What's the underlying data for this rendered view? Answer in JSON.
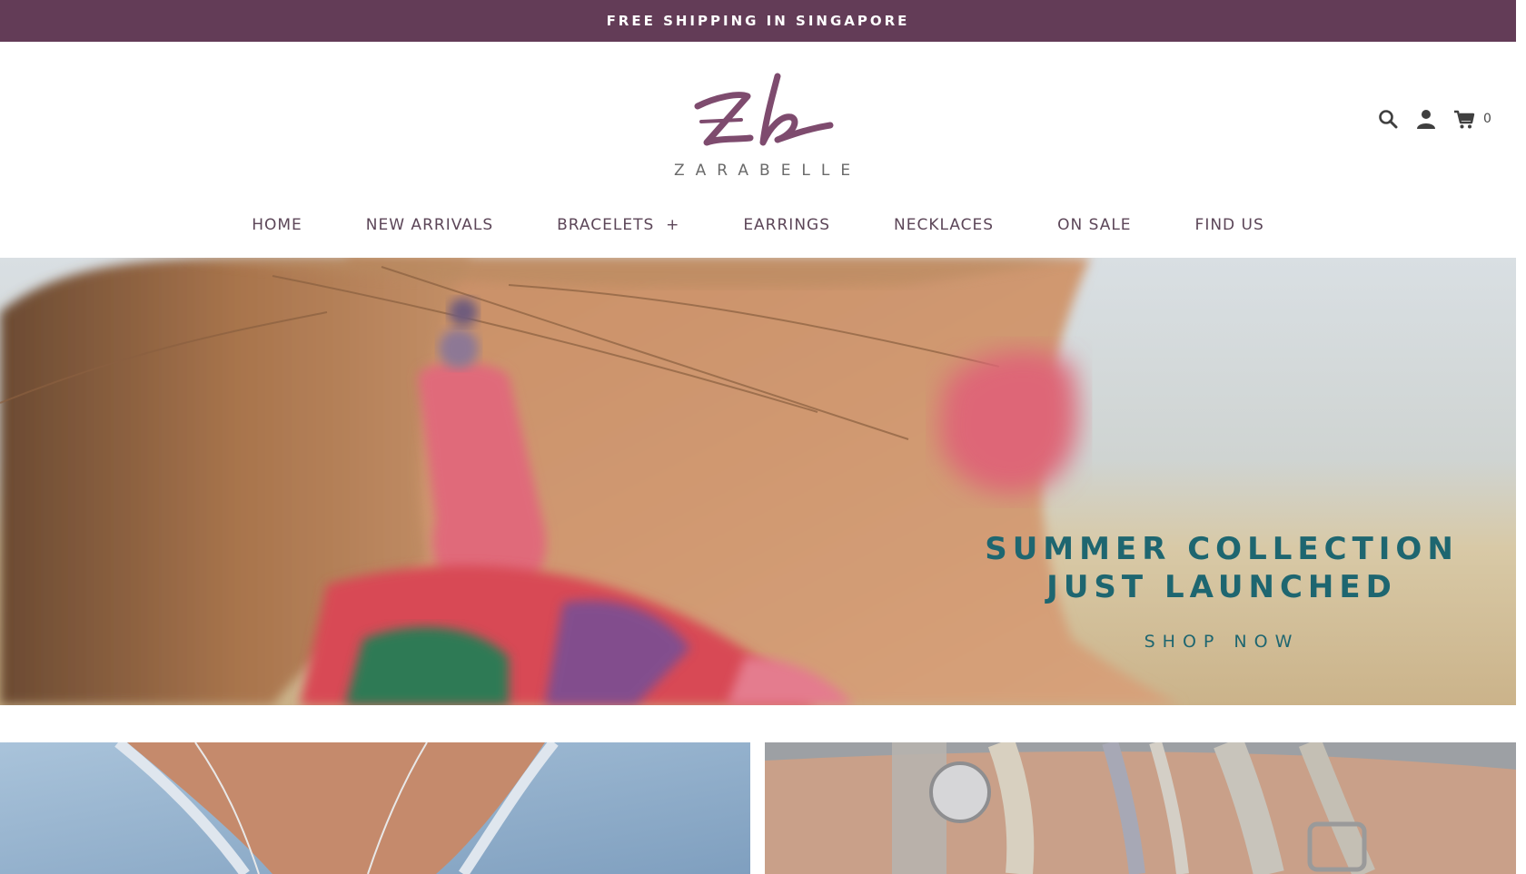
{
  "announcement": {
    "text": "FREE SHIPPING IN SINGAPORE"
  },
  "brand": {
    "wordmark": "ZARABELLE",
    "monogram": "zb",
    "color": "#7e4b6e"
  },
  "header_tools": {
    "search_icon": "search-icon",
    "account_icon": "user-icon",
    "cart_icon": "cart-icon",
    "cart_count": "0"
  },
  "nav": {
    "items": [
      {
        "label": "HOME"
      },
      {
        "label": "NEW ARRIVALS"
      },
      {
        "label": "BRACELETS  +"
      },
      {
        "label": "EARRINGS"
      },
      {
        "label": "NECKLACES"
      },
      {
        "label": "ON SALE"
      },
      {
        "label": "FIND US"
      }
    ]
  },
  "hero": {
    "title_line1": "SUMMER COLLECTION",
    "title_line2": "JUST LAUNCHED",
    "cta": "SHOP NOW",
    "accent": "#1e6670"
  },
  "colors": {
    "announce_bg": "#633c57",
    "nav_text": "#5c4658"
  }
}
